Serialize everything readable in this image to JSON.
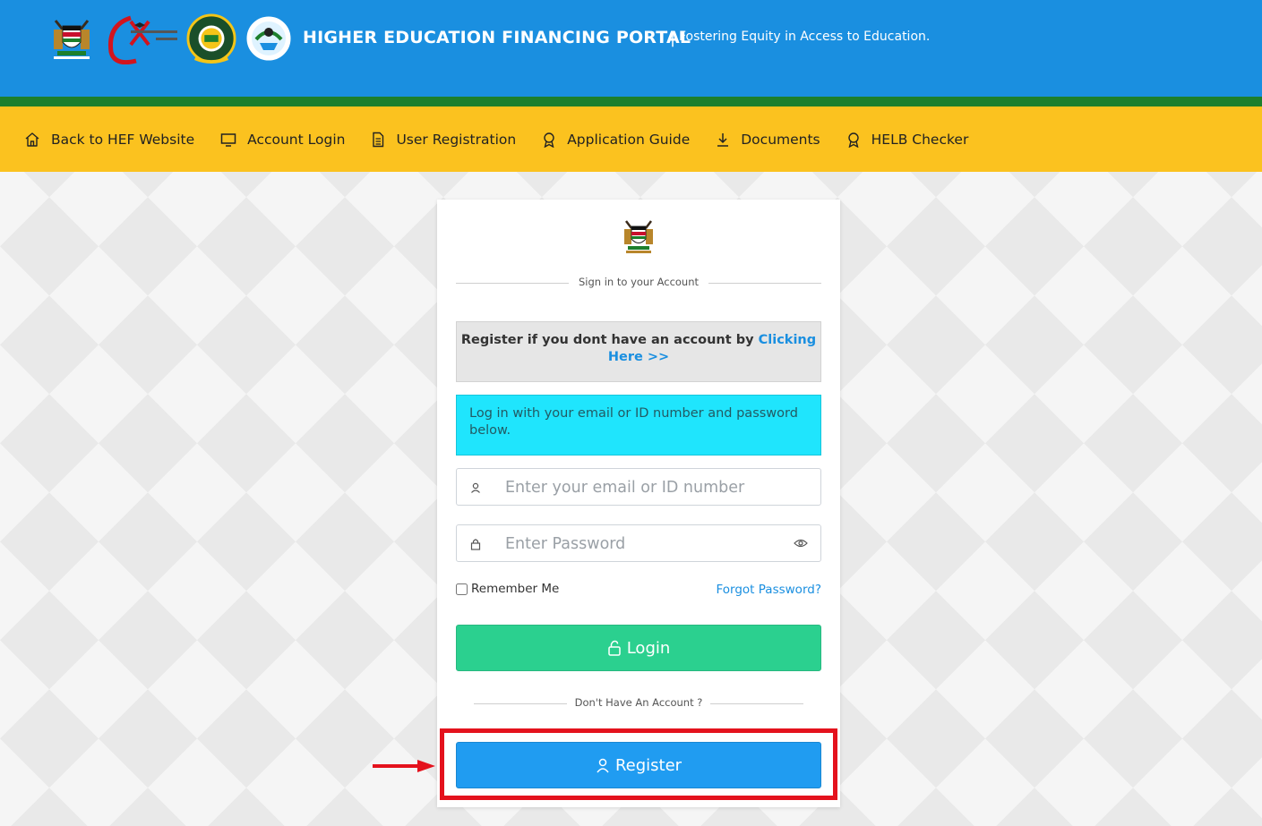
{
  "header": {
    "title": "HIGHER EDUCATION FINANCING PORTAL",
    "separator": "|",
    "tagline": "Fostering Equity in Access to Education."
  },
  "logos": [
    "kenya-coat-of-arms-icon",
    "ministry-logo-icon",
    "helb-logo-icon",
    "universities-fund-logo-icon"
  ],
  "nav": {
    "items": [
      {
        "label": "Back to HEF Website",
        "icon": "home-icon"
      },
      {
        "label": "Account Login",
        "icon": "monitor-icon"
      },
      {
        "label": "User Registration",
        "icon": "document-icon"
      },
      {
        "label": "Application Guide",
        "icon": "award-icon"
      },
      {
        "label": "Documents",
        "icon": "download-icon"
      },
      {
        "label": "HELB Checker",
        "icon": "award-icon"
      }
    ]
  },
  "card": {
    "signin_text": "Sign in to your Account",
    "register_prompt": "Register if you dont have an account by",
    "register_link": "Clicking Here >>",
    "info_text": "Log in with your email or ID number and password below.",
    "email_placeholder": "Enter your email or ID number",
    "password_placeholder": "Enter Password",
    "remember_label": "Remember Me",
    "forgot_label": "Forgot Password?",
    "login_label": "Login",
    "no_account_text": "Don't Have An Account ?",
    "register_label": "Register"
  },
  "colors": {
    "header_blue": "#1a8fe0",
    "nav_yellow": "#fbc21f",
    "green_strip": "#1d7f2c",
    "login_green": "#2bd08f",
    "register_blue": "#209cf1",
    "highlight_red": "#e4121d",
    "info_cyan": "#1fe5fd"
  }
}
